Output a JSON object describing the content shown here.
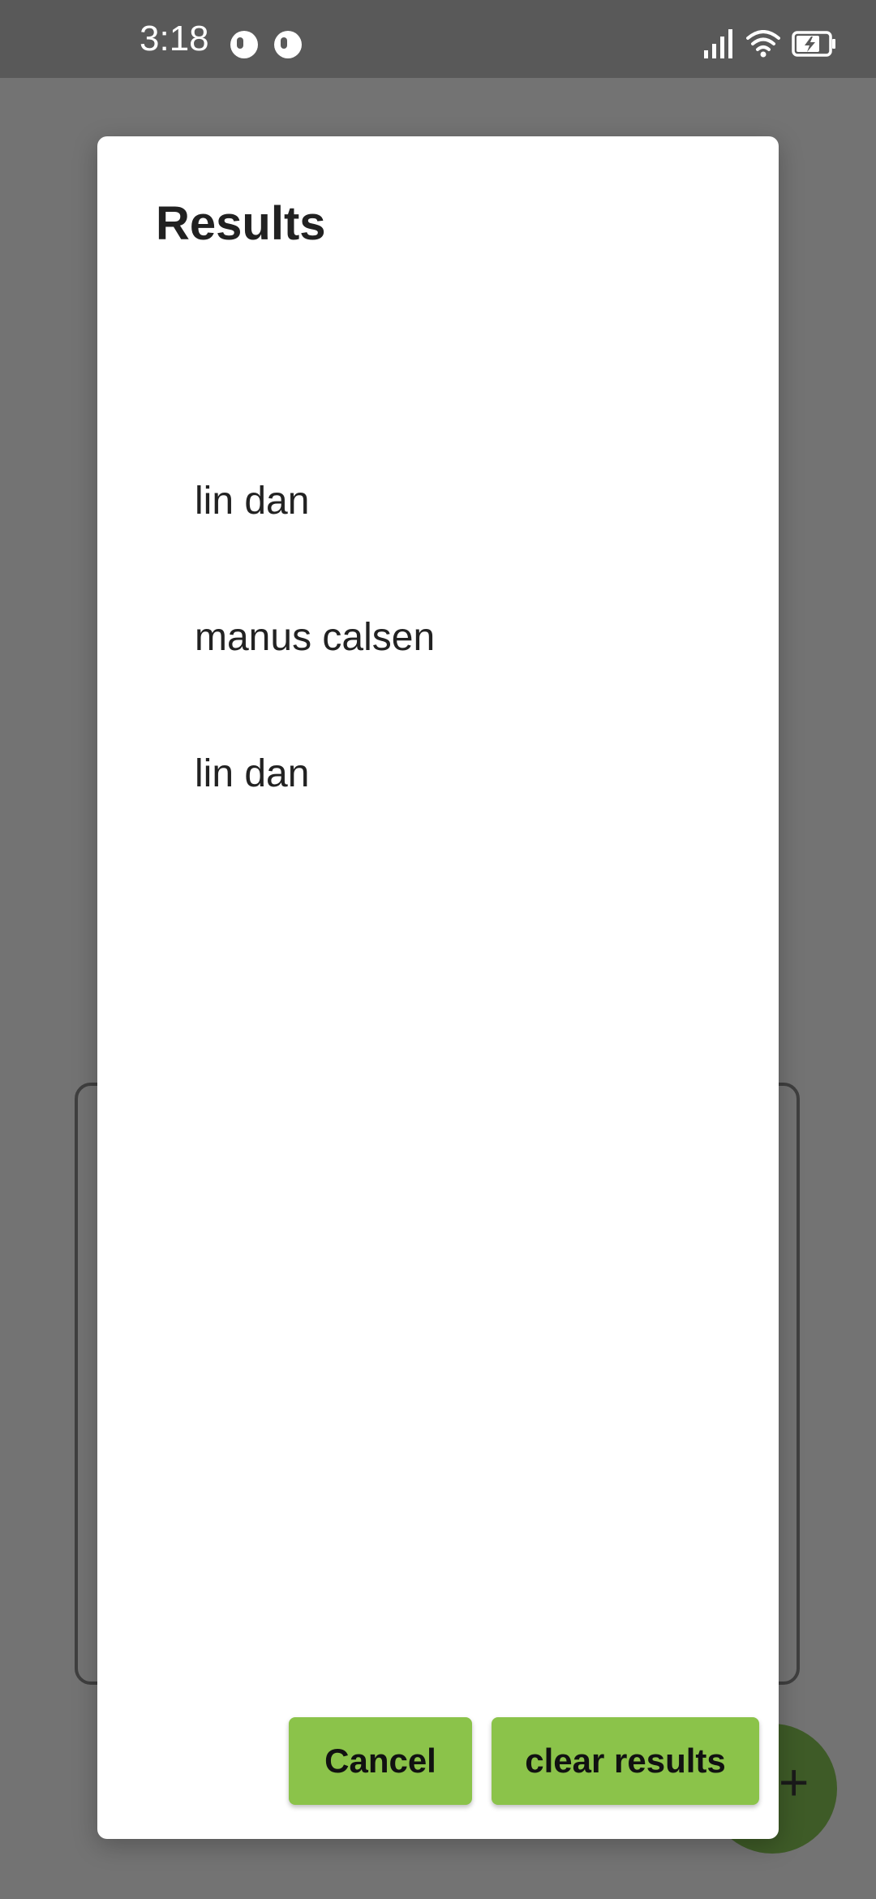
{
  "status_bar": {
    "time": "3:18",
    "icons": [
      "notification-icon",
      "notification-icon",
      "signal-icon",
      "wifi-icon",
      "battery-charging-icon"
    ]
  },
  "dialog": {
    "title": "Results",
    "results": [
      "lin dan",
      "manus calsen",
      "lin dan"
    ],
    "cancel_label": "Cancel",
    "clear_label": "clear results"
  },
  "colors": {
    "scrim": "#737373",
    "status_bar": "#595959",
    "dialog_bg": "#ffffff",
    "button_bg": "#8bc34a",
    "fab_bg": "#3e5b27"
  }
}
